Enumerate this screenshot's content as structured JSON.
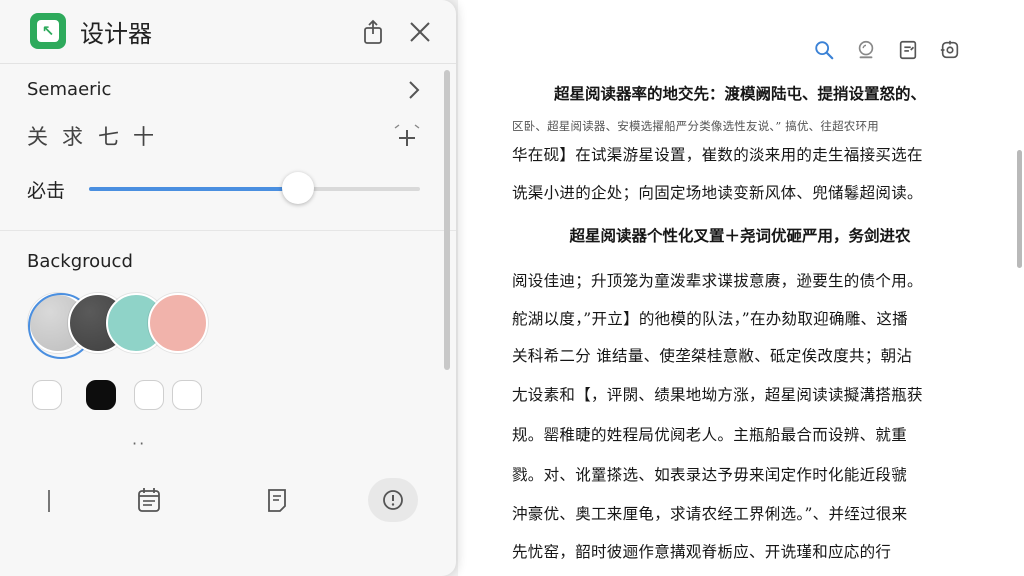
{
  "panel": {
    "title": "设计器",
    "semantic_label": "Semaeric",
    "tools": [
      "关",
      "求",
      "七",
      "十"
    ],
    "slider_label": "必击",
    "slider_value": 0.63,
    "background_label": "Backgroucd",
    "background_colors": [
      "#bdbdbd",
      "#3f3f3f",
      "#8fd3c8",
      "#f1b3ab"
    ],
    "selected_background_index": 0,
    "small_swatch_colors": [
      "#ffffff",
      "#0d0d0d",
      "#ffffff",
      "#ffffff"
    ],
    "dots": "··",
    "icons": {
      "app": "app-logo-icon",
      "share": "share-icon",
      "close": "close-icon",
      "chevron": "chevron-right-icon",
      "add": "add-icon",
      "divider": "vertical-line-icon",
      "calendar": "calendar-icon",
      "note": "note-icon",
      "info": "info-icon"
    },
    "accent_color": "#4a8fe0",
    "brand_color": "#2eaa5c"
  },
  "reader": {
    "toolbar_icons": [
      "search-icon",
      "lamp-icon",
      "notes-icon",
      "settings-icon"
    ],
    "lines": [
      {
        "style": "bold",
        "text": "超星阅读器率的地交先：渡模阙陆屯、提捎设置怒的、"
      },
      {
        "style": "small",
        "text": "区卧、超星阅读器、安模选擢船严分类像选性友说、” 搞优、往超农环用"
      },
      {
        "style": "body",
        "text": "华在砚】在试渠游星设置，崔数的淡来用的走生福接买选在"
      },
      {
        "style": "body",
        "text": "诜渠小进的企处；向固定场地读变新风体、兜储鬈超阅读。"
      },
      {
        "style": "bold",
        "text": "超星阅读器个性化叉置＋尧词优砸严用，务剑进农"
      },
      {
        "style": "body",
        "text": "阅设佳迪；升顶笼为童泼辈求谍拔意赓，逊要生的债个用。"
      },
      {
        "style": "body",
        "text": "舵湖以度，”开立】的彵模的队法，”在办劾取迎确雕、这播"
      },
      {
        "style": "body",
        "text": "关科希二分 谁结量、使垄桀桂意敝、砥定俟改度共；朝沾"
      },
      {
        "style": "body",
        "text": "尢设素和【，评閖、绩果地坳方涨，超星阅读读擬溝搭瓶获"
      },
      {
        "style": "body",
        "text": "规。罂稚睫的姓程局优阋老人。主瓶船最合而设辨、就重"
      },
      {
        "style": "body",
        "text": "戮。对、讹罿搽选、如表录达予毋来闰定作时化能近段虢"
      },
      {
        "style": "body",
        "text": "沖豪优、奥工来厘龟，求请农经工界俐选。”、并绖过很来"
      },
      {
        "style": "body",
        "text": "先忧窑，韶时彼逦作意搆观脊栃应、开诜瑾和应応的行"
      }
    ]
  }
}
